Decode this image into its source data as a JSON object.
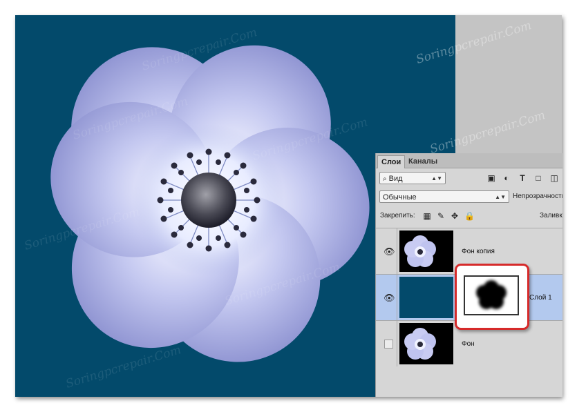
{
  "watermark": "Soringpcrepair.Com",
  "colors": {
    "canvas_bg": "#034a6b",
    "panel_bg": "#d6d6d6",
    "selected_layer": "#b3c9ee",
    "mask_highlight": "#d62a2a"
  },
  "panel": {
    "tabs": [
      "Слои",
      "Каналы"
    ],
    "filter": {
      "label": "Вид",
      "icons": [
        "image-filter-icon",
        "adjustment-filter-icon",
        "text-filter-icon",
        "shape-filter-icon",
        "smart-object-filter-icon"
      ]
    },
    "blend_mode": "Обычные",
    "opacity_label": "Непрозрачность",
    "lock_label": "Закрепить:",
    "fill_label": "Заливка",
    "layers": [
      {
        "name": "Фон копия",
        "visible": true,
        "selected": false
      },
      {
        "name": "Слой 1",
        "visible": true,
        "selected": true
      },
      {
        "name": "Фон",
        "visible": false,
        "selected": false
      }
    ]
  }
}
